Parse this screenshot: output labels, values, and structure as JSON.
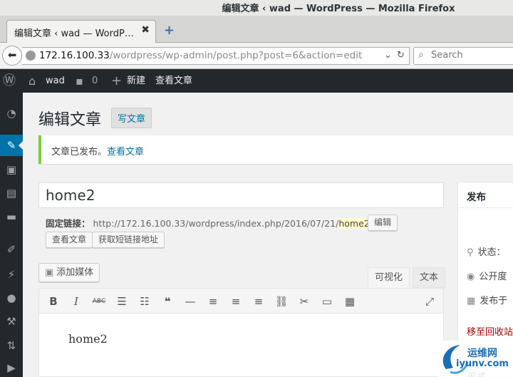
{
  "browser": {
    "window_title": "编辑文章 ‹ wad — WordPress — Mozilla Firefox",
    "tab_title": "编辑文章 ‹ wad — WordP…",
    "tab_close": "✖",
    "new_tab": "+",
    "url_host": "172.16.100.33",
    "url_path": "/wordpress/wp-admin/post.php?post=6&action=edit",
    "search_placeholder": "Search"
  },
  "adminbar": {
    "site_name": "wad",
    "comments_count": "0",
    "new_label": "新建",
    "view_post": "查看文章"
  },
  "page": {
    "title": "编辑文章",
    "add_new": "写文章"
  },
  "notice": {
    "text": "文章已发布。",
    "link": "查看文章"
  },
  "post": {
    "title": "home2",
    "permalink_label": "固定链接：",
    "permalink_base": "http://172.16.100.33/wordpress/index.php/2016/07/21/",
    "permalink_slug": "home2",
    "permalink_end": "/",
    "edit_button": "编辑",
    "view_button": "查看文章",
    "shortlink_button": "获取短链接地址",
    "content": "home2"
  },
  "editor": {
    "add_media": "添加媒体",
    "tab_visual": "可视化",
    "tab_text": "文本"
  },
  "publish": {
    "heading": "发布",
    "status_label": "状态：",
    "visibility_label": "公开度",
    "publish_on_label": "发布于",
    "trash_link": "移至回收站",
    "truncated_line": "形式"
  },
  "watermark": {
    "line1": "运维网",
    "line2": "iyunv.com"
  }
}
